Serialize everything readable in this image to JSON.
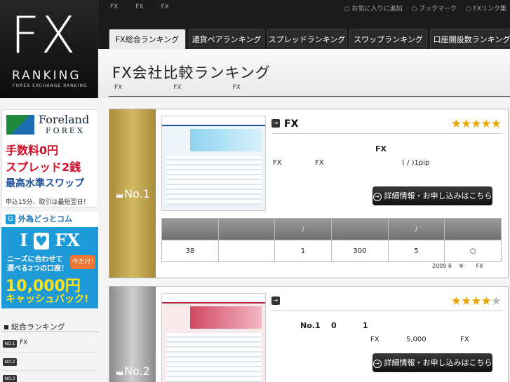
{
  "logo": {
    "big": "FX",
    "word": "RANKING",
    "sub": "FOREX EXCHANGE RANKING"
  },
  "topnav": [
    "FX",
    "FX",
    "FX"
  ],
  "toplinks": [
    "○ お気に入りに追加",
    "○ ブックマーク",
    "○ FXリンク集"
  ],
  "tabs": [
    "FX総合ランキング",
    "通貨ペアランキング",
    "スプレッドランキング",
    "スワップランキング",
    "口座開設数ランキング"
  ],
  "page": {
    "title": "FX会社比較ランキング",
    "sub": [
      "FX",
      "FX",
      "FX"
    ]
  },
  "ad1": {
    "name": "Foreland",
    "forex": "FOREX",
    "line1": "手数料0円",
    "line2": "スプレッド2銭",
    "line3": "最高水準スワップ",
    "foot": "申込15分、取引は最短翌日！"
  },
  "ad2": {
    "brand": "外為どっとコム",
    "badge": "G",
    "ilove_a": "I",
    "heart": "♥",
    "ilove_b": "FX",
    "msg": "ニーズに合わせて\n選べる2つの口座！",
    "now": "今だけ!",
    "amount": "10,000円",
    "cash": "キャッシュバック!"
  },
  "sidebar": {
    "heading": "総合ランキング",
    "items": [
      {
        "badge": "NO.1",
        "label": "FX"
      },
      {
        "badge": "NO.2",
        "label": ""
      },
      {
        "badge": "NO.3",
        "label": ""
      }
    ]
  },
  "cards": [
    {
      "rank": "No.1",
      "arrow": "→",
      "name": "FX",
      "stars": 5,
      "info_center": "FX",
      "info_left": "FX",
      "info_mid": "FX",
      "info_right": "( / )1pip",
      "cta": "詳細情報・お申し込みはこちら",
      "spec_headers": [
        "",
        "",
        "/",
        "",
        "/",
        ""
      ],
      "spec_values": [
        "38",
        "",
        "1",
        "300",
        "5",
        "○"
      ],
      "note": "2009 8    ※       FX"
    },
    {
      "rank": "No.2",
      "arrow": "→",
      "name": "",
      "stars": 4,
      "info_center_a": "No.1",
      "info_center_b": "0",
      "info_center_c": "1",
      "info_left": "FX",
      "info_mid": "5,000",
      "info_right": "FX",
      "cta": "詳細情報・お申し込みはこちら"
    }
  ],
  "colors": {
    "accent_gold": "#c8ac56",
    "star": "#e8a500",
    "dark": "#1b1b1b"
  }
}
